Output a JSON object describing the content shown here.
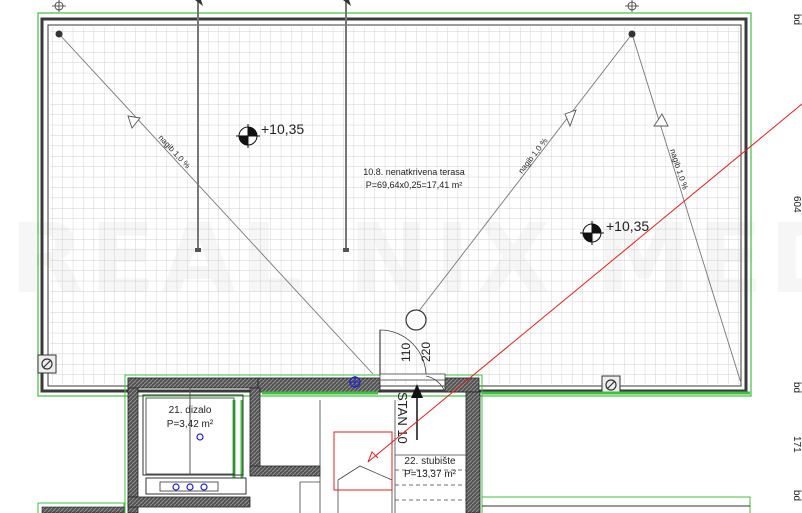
{
  "terrace": {
    "name": "10.8. nenatkrivena terasa",
    "area": "P=69,64x0,25=17,41 m²",
    "level_left": "+10,35",
    "level_right": "+10,35",
    "slope_1": "nagib 1,0 %",
    "slope_2": "nagib 1,0 %",
    "slope_3": "nagib 1,0 %"
  },
  "elevator": {
    "name": "21. dizalo",
    "area": "P=3,42 m²"
  },
  "stairs": {
    "name": "22. stubište",
    "area": "P=13,37 m²",
    "direction": "STAN 10",
    "dim_1": "110",
    "dim_2": "220"
  },
  "margin": {
    "top": "bd",
    "dim_a": "604",
    "mid": "bd",
    "dim_b": "171",
    "bottom": "bd"
  },
  "watermark": "REAL NIX MEDIA",
  "colors": {
    "green": "#3fbf3f",
    "red": "#e02020",
    "blue": "#2020d0",
    "grid": "#c8c8c8",
    "wall": "#3a3a3a"
  }
}
